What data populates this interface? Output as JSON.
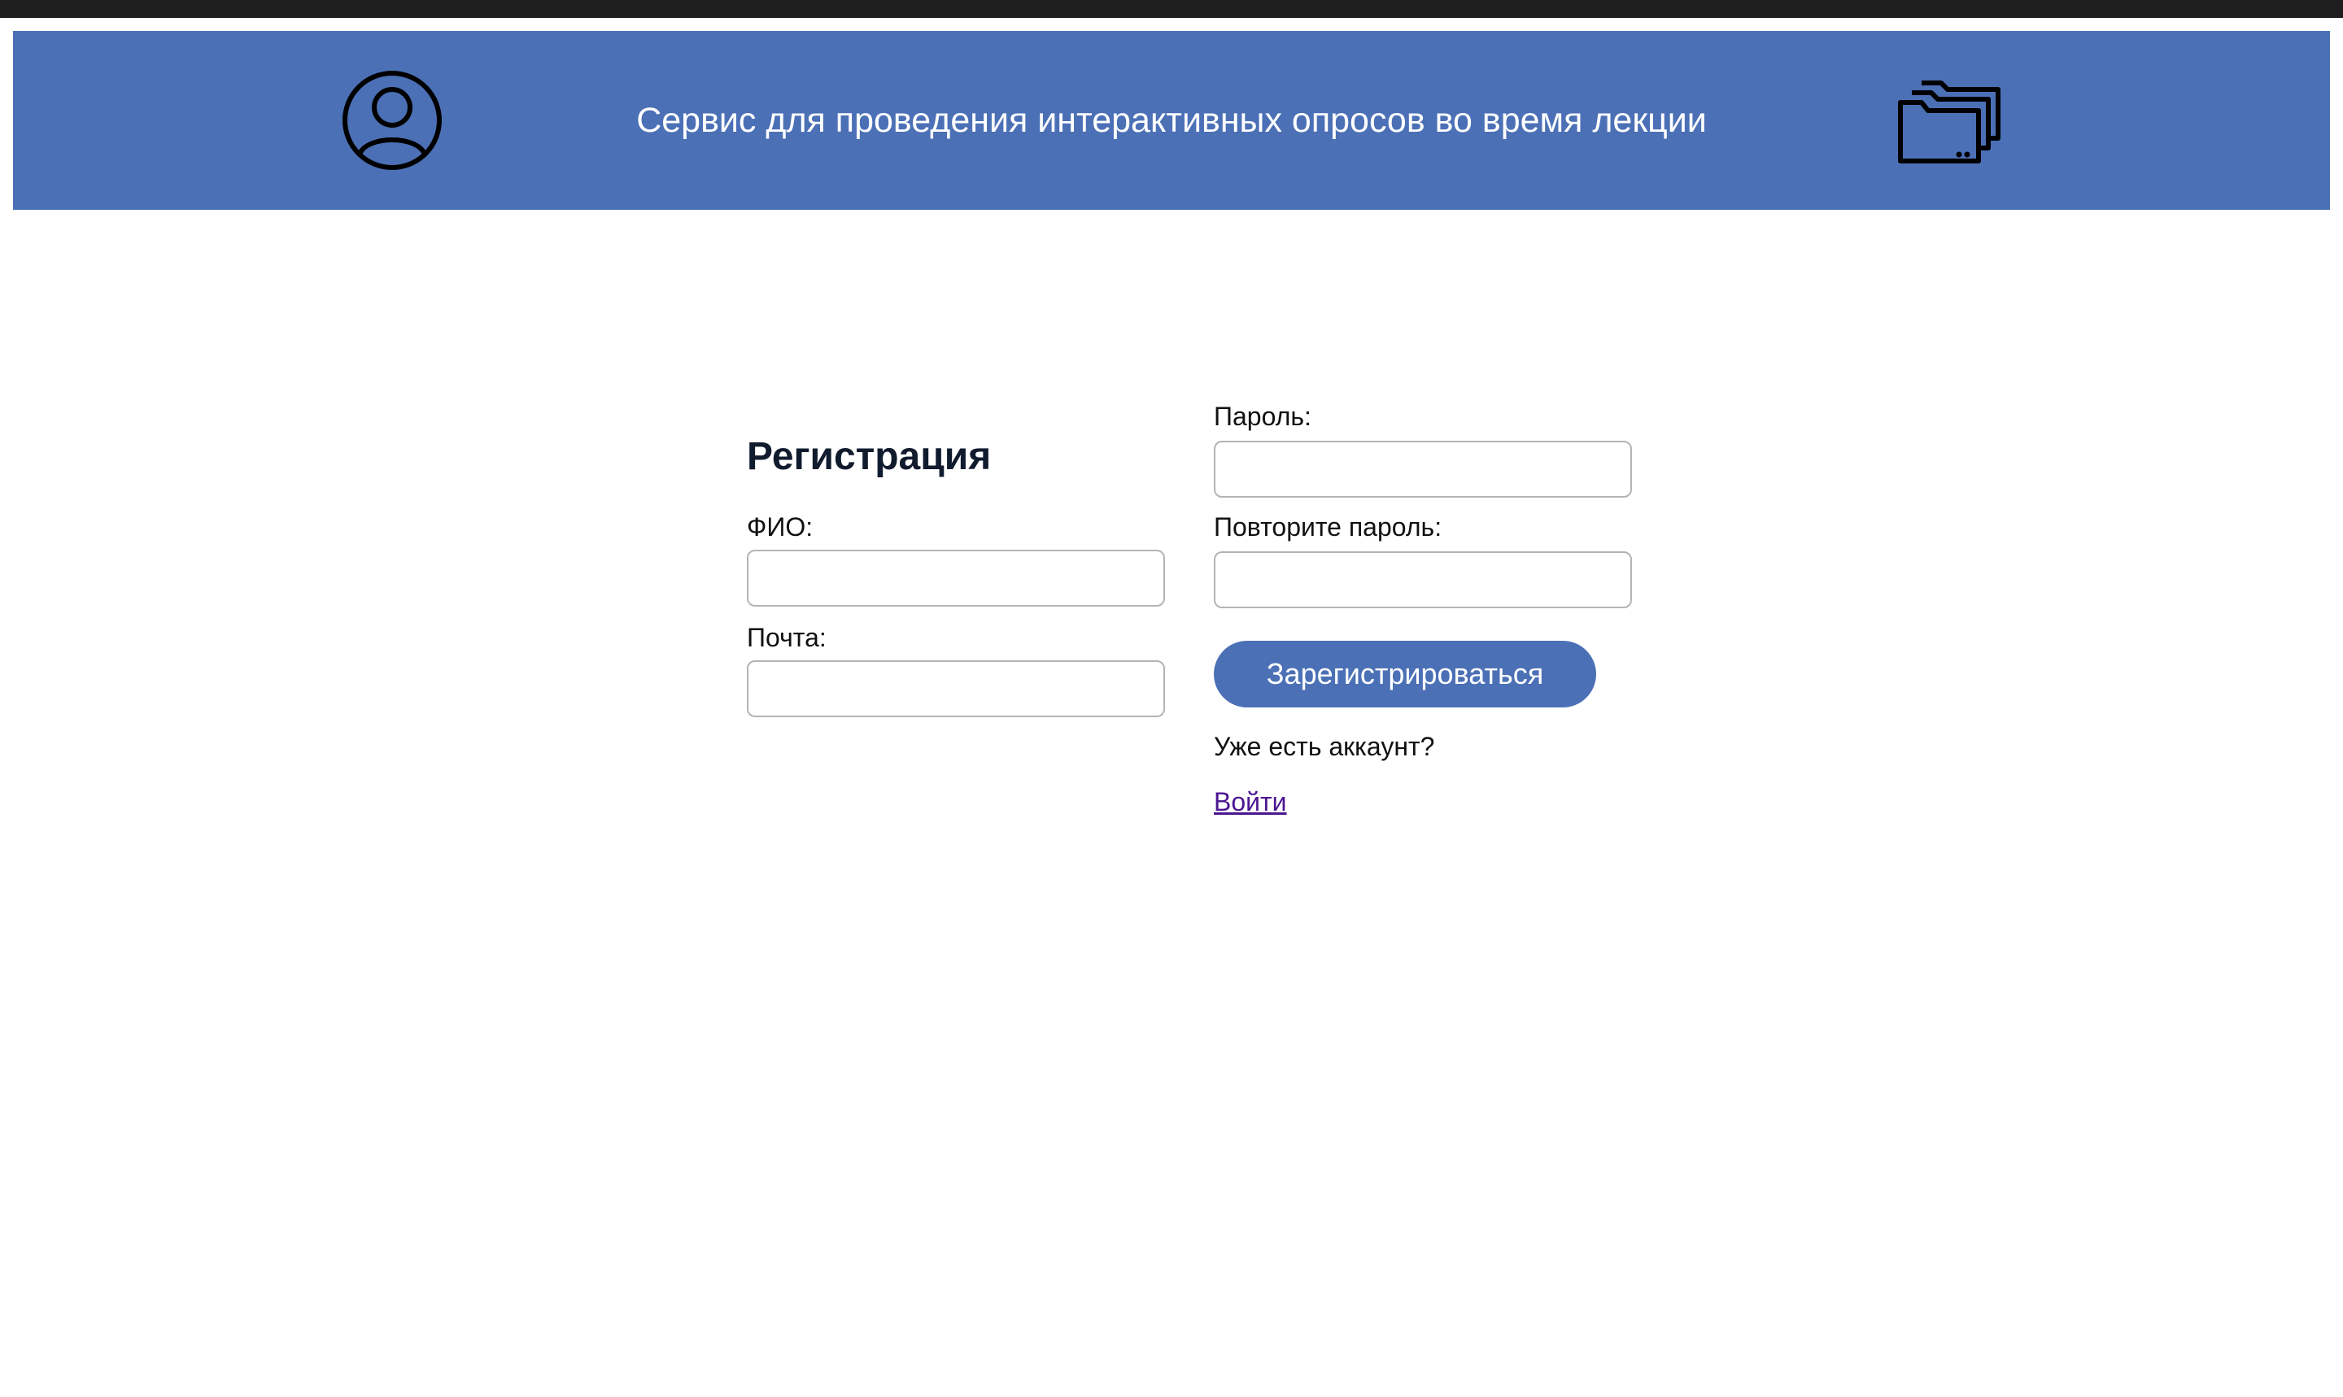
{
  "header": {
    "title": "Сервис для проведения интерактивных опросов во время лекции",
    "profile_icon": "user-circle-icon",
    "folders_icon": "folders-icon",
    "background_color": "#4b70b6"
  },
  "form": {
    "title": "Регистрация",
    "full_name_label": "ФИО:",
    "full_name_value": "",
    "email_label": "Почта:",
    "email_value": "",
    "password_label": "Пароль:",
    "password_value": "",
    "repeat_password_label": "Повторите пароль:",
    "repeat_password_value": "",
    "submit_label": "Зарегистрироваться",
    "have_account_text": "Уже есть аккаунт?",
    "login_link": "Войти"
  },
  "colors": {
    "accent": "#4b70b6",
    "link": "#4b1590",
    "title_text": "#111b2e"
  }
}
